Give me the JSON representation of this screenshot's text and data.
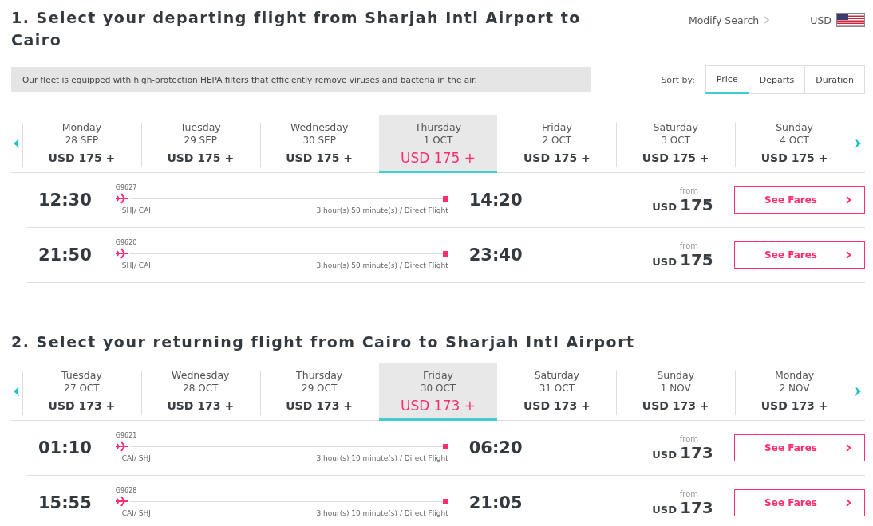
{
  "header": {
    "modify_search": "Modify Search",
    "currency": "USD"
  },
  "sections": [
    {
      "title": "1. Select your departing flight from Sharjah Intl Airport to Cairo",
      "notice": "Our fleet is equipped with high-protection HEPA filters that efficiently remove viruses and bacteria in the air.",
      "sort": {
        "label": "Sort by:",
        "options": [
          {
            "label": "Price",
            "selected": true
          },
          {
            "label": "Departs",
            "selected": false
          },
          {
            "label": "Duration",
            "selected": false
          }
        ]
      },
      "dates": [
        {
          "day": "Monday",
          "date": "28 SEP",
          "price": "USD 175 +",
          "selected": false
        },
        {
          "day": "Tuesday",
          "date": "29 SEP",
          "price": "USD 175 +",
          "selected": false
        },
        {
          "day": "Wednesday",
          "date": "30 SEP",
          "price": "USD 175 +",
          "selected": false
        },
        {
          "day": "Thursday",
          "date": "1 OCT",
          "price": "USD 175 +",
          "selected": true
        },
        {
          "day": "Friday",
          "date": "2 OCT",
          "price": "USD 175 +",
          "selected": false
        },
        {
          "day": "Saturday",
          "date": "3 OCT",
          "price": "USD 175 +",
          "selected": false
        },
        {
          "day": "Sunday",
          "date": "4 OCT",
          "price": "USD 175 +",
          "selected": false
        }
      ],
      "flights": [
        {
          "number": "G9627",
          "depart": "12:30",
          "arrive": "14:20",
          "route": "SHJ/ CAI",
          "duration": "3 hour(s) 50 minute(s) / Direct Flight",
          "from": "from",
          "currency": "USD",
          "price": "175",
          "button": "See Fares"
        },
        {
          "number": "G9620",
          "depart": "21:50",
          "arrive": "23:40",
          "route": "SHJ/ CAI",
          "duration": "3 hour(s) 50 minute(s) / Direct Flight",
          "from": "from",
          "currency": "USD",
          "price": "175",
          "button": "See Fares"
        }
      ]
    },
    {
      "title": "2. Select your returning flight from Cairo to Sharjah Intl Airport",
      "dates": [
        {
          "day": "Tuesday",
          "date": "27 OCT",
          "price": "USD 173 +",
          "selected": false
        },
        {
          "day": "Wednesday",
          "date": "28 OCT",
          "price": "USD 173 +",
          "selected": false
        },
        {
          "day": "Thursday",
          "date": "29 OCT",
          "price": "USD 173 +",
          "selected": false
        },
        {
          "day": "Friday",
          "date": "30 OCT",
          "price": "USD 173 +",
          "selected": true
        },
        {
          "day": "Saturday",
          "date": "31 OCT",
          "price": "USD 173 +",
          "selected": false
        },
        {
          "day": "Sunday",
          "date": "1 NOV",
          "price": "USD 173 +",
          "selected": false
        },
        {
          "day": "Monday",
          "date": "2 NOV",
          "price": "USD 173 +",
          "selected": false
        }
      ],
      "flights": [
        {
          "number": "G9621",
          "depart": "01:10",
          "arrive": "06:20",
          "route": "CAI/ SHJ",
          "duration": "3 hour(s) 10 minute(s) / Direct Flight",
          "from": "from",
          "currency": "USD",
          "price": "173",
          "button": "See Fares"
        },
        {
          "number": "G9628",
          "depart": "15:55",
          "arrive": "21:05",
          "route": "CAI/ SHJ",
          "duration": "3 hour(s) 10 minute(s) / Direct Flight",
          "from": "from",
          "currency": "USD",
          "price": "173",
          "button": "See Fares"
        }
      ]
    }
  ]
}
